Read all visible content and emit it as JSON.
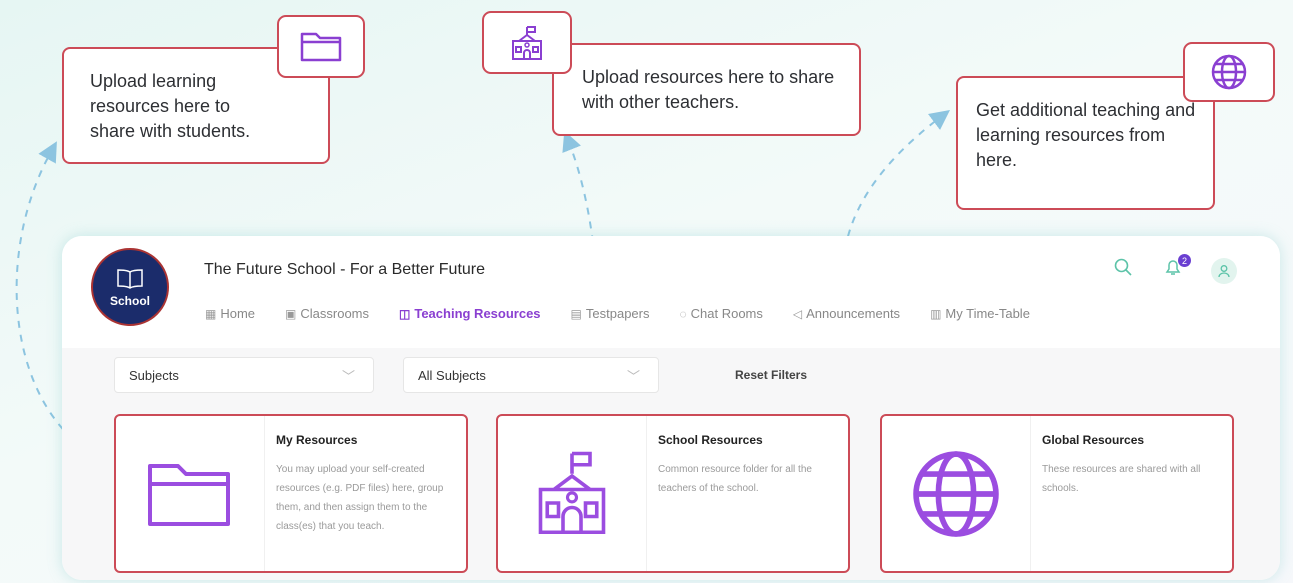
{
  "callouts": [
    {
      "id": "my",
      "text": "Upload learning resources here to share with students.",
      "icon": "folder-icon"
    },
    {
      "id": "school",
      "text": "Upload resources here to share with other teachers.",
      "icon": "school-building-icon"
    },
    {
      "id": "global",
      "text": "Get additional teaching and learning resources from here.",
      "icon": "globe-icon"
    }
  ],
  "header": {
    "logo_text": "School",
    "school_title": "The Future School - For a Better Future",
    "notification_count": "2",
    "icons": [
      "search-icon",
      "bell-icon",
      "user-icon"
    ]
  },
  "nav": {
    "items": [
      {
        "label": "Home",
        "icon": "grid-icon"
      },
      {
        "label": "Classrooms",
        "icon": "classroom-icon"
      },
      {
        "label": "Teaching Resources",
        "icon": "book-icon",
        "active": true
      },
      {
        "label": "Testpapers",
        "icon": "document-icon"
      },
      {
        "label": "Chat Rooms",
        "icon": "chat-icon"
      },
      {
        "label": "Announcements",
        "icon": "megaphone-icon"
      },
      {
        "label": "My Time-Table",
        "icon": "calendar-icon"
      }
    ]
  },
  "filters": {
    "subjects_value": "Subjects",
    "all_subjects_value": "All Subjects",
    "reset_label": "Reset Filters"
  },
  "cards": [
    {
      "title": "My Resources",
      "description": "You may upload your self-created resources (e.g. PDF files) here, group them, and then assign them to the class(es) that you teach.",
      "icon": "folder-icon"
    },
    {
      "title": "School Resources",
      "description": "Common resource folder for all the teachers of the school.",
      "icon": "school-building-icon"
    },
    {
      "title": "Global Resources",
      "description": "These resources are shared with all schools.",
      "icon": "globe-icon"
    }
  ],
  "colors": {
    "accent": "#8a3fd1",
    "callout_border": "#cc4b57",
    "teal": "#5cc3a8",
    "dashed_arrow": "#8cc4e0"
  }
}
